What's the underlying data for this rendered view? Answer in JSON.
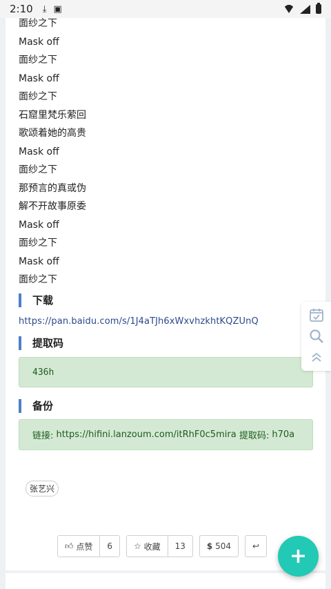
{
  "status_bar": {
    "time": "2:10",
    "icons": [
      "download-icon",
      "a-icon",
      "wifi-icon",
      "signal-icon",
      "battery-icon"
    ]
  },
  "lyrics": [
    "面纱之下",
    "Mask off",
    "面纱之下",
    "Mask off",
    "面纱之下",
    "石窟里梵乐萦回",
    "歌颂着她的高贵",
    "Mask off",
    "面纱之下",
    "那预言的真或伪",
    "解不开故事原委",
    "Mask off",
    "面纱之下",
    "Mask off",
    "面纱之下"
  ],
  "download": {
    "heading": "下载",
    "link": "https://pan.baidu.com/s/1J4aTJh6xWxvhzkhtKQZUnQ"
  },
  "extract_code": {
    "heading": "提取码",
    "code": "436h"
  },
  "backup": {
    "heading": "备份",
    "label": "链接:",
    "link": "https://hifini.lanzoum.com/itRhF0c5mira",
    "code_label": "提取码:",
    "code": "h70a"
  },
  "tag": "张艺兴",
  "actions": {
    "like_label": "点赞",
    "like_count": "6",
    "fav_label": "收藏",
    "fav_count": "13",
    "coin_value": "504"
  },
  "colors": {
    "accent_bar": "#4d7fc9",
    "code_bg": "#d4e9d4",
    "fab": "#22c9b5"
  }
}
